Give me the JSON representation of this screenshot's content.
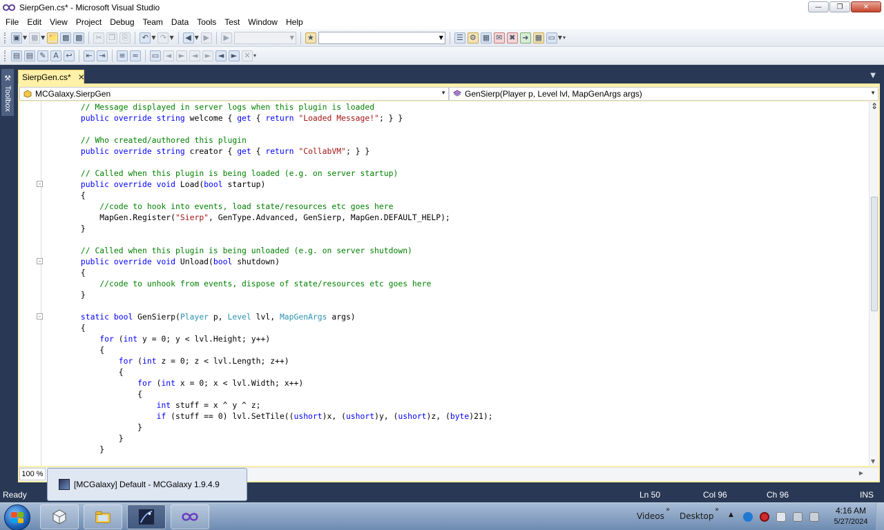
{
  "window": {
    "title": "SierpGen.cs* - Microsoft Visual Studio",
    "minimize_icon": "minimize-icon",
    "maximize_icon": "maximize-icon",
    "close_icon": "close-icon"
  },
  "menu": [
    "File",
    "Edit",
    "View",
    "Project",
    "Debug",
    "Team",
    "Data",
    "Tools",
    "Test",
    "Window",
    "Help"
  ],
  "toolbox": {
    "label": "Toolbox"
  },
  "editor_tab": {
    "label": "SierpGen.cs*"
  },
  "navbar": {
    "type_combo": "MCGalaxy.SierpGen",
    "member_combo": "GenSierp(Player p, Level lvl, MapGenArgs args)"
  },
  "code": {
    "lines": [
      [
        {
          "t": "        "
        },
        {
          "c": "cm",
          "t": "// Message displayed in server logs when this plugin is loaded"
        }
      ],
      [
        {
          "t": "        "
        },
        {
          "c": "kw",
          "t": "public override string"
        },
        {
          "t": " welcome { "
        },
        {
          "c": "kw",
          "t": "get"
        },
        {
          "t": " { "
        },
        {
          "c": "kw",
          "t": "return"
        },
        {
          "t": " "
        },
        {
          "c": "str",
          "t": "\"Loaded Message!\""
        },
        {
          "t": "; } }"
        }
      ],
      [
        {
          "t": ""
        }
      ],
      [
        {
          "t": "        "
        },
        {
          "c": "cm",
          "t": "// Who created/authored this plugin"
        }
      ],
      [
        {
          "t": "        "
        },
        {
          "c": "kw",
          "t": "public override string"
        },
        {
          "t": " creator { "
        },
        {
          "c": "kw",
          "t": "get"
        },
        {
          "t": " { "
        },
        {
          "c": "kw",
          "t": "return"
        },
        {
          "t": " "
        },
        {
          "c": "str",
          "t": "\"CollabVM\""
        },
        {
          "t": "; } }"
        }
      ],
      [
        {
          "t": ""
        }
      ],
      [
        {
          "t": "        "
        },
        {
          "c": "cm",
          "t": "// Called when this plugin is being loaded (e.g. on server startup)"
        }
      ],
      [
        {
          "t": "        "
        },
        {
          "c": "kw",
          "t": "public override void"
        },
        {
          "t": " Load("
        },
        {
          "c": "kw",
          "t": "bool"
        },
        {
          "t": " startup)"
        }
      ],
      [
        {
          "t": "        {"
        }
      ],
      [
        {
          "t": "            "
        },
        {
          "c": "cm",
          "t": "//code to hook into events, load state/resources etc goes here"
        }
      ],
      [
        {
          "t": "            MapGen.Register("
        },
        {
          "c": "str",
          "t": "\"Sierp\""
        },
        {
          "t": ", GenType.Advanced, GenSierp, MapGen.DEFAULT_HELP);"
        }
      ],
      [
        {
          "t": "        }"
        }
      ],
      [
        {
          "t": ""
        }
      ],
      [
        {
          "t": "        "
        },
        {
          "c": "cm",
          "t": "// Called when this plugin is being unloaded (e.g. on server shutdown)"
        }
      ],
      [
        {
          "t": "        "
        },
        {
          "c": "kw",
          "t": "public override void"
        },
        {
          "t": " Unload("
        },
        {
          "c": "kw",
          "t": "bool"
        },
        {
          "t": " shutdown)"
        }
      ],
      [
        {
          "t": "        {"
        }
      ],
      [
        {
          "t": "            "
        },
        {
          "c": "cm",
          "t": "//code to unhook from events, dispose of state/resources etc goes here"
        }
      ],
      [
        {
          "t": "        }"
        }
      ],
      [
        {
          "t": ""
        }
      ],
      [
        {
          "t": "        "
        },
        {
          "c": "kw",
          "t": "static bool"
        },
        {
          "t": " GenSierp("
        },
        {
          "c": "ty",
          "t": "Player"
        },
        {
          "t": " p, "
        },
        {
          "c": "ty",
          "t": "Level"
        },
        {
          "t": " lvl, "
        },
        {
          "c": "ty",
          "t": "MapGenArgs"
        },
        {
          "t": " args)"
        }
      ],
      [
        {
          "t": "        {"
        }
      ],
      [
        {
          "t": "            "
        },
        {
          "c": "kw",
          "t": "for"
        },
        {
          "t": " ("
        },
        {
          "c": "kw",
          "t": "int"
        },
        {
          "t": " y = 0; y < lvl.Height; y++)"
        }
      ],
      [
        {
          "t": "            {"
        }
      ],
      [
        {
          "t": "                "
        },
        {
          "c": "kw",
          "t": "for"
        },
        {
          "t": " ("
        },
        {
          "c": "kw",
          "t": "int"
        },
        {
          "t": " z = 0; z < lvl.Length; z++)"
        }
      ],
      [
        {
          "t": "                {"
        }
      ],
      [
        {
          "t": "                    "
        },
        {
          "c": "kw",
          "t": "for"
        },
        {
          "t": " ("
        },
        {
          "c": "kw",
          "t": "int"
        },
        {
          "t": " x = 0; x < lvl.Width; x++)"
        }
      ],
      [
        {
          "t": "                    {"
        }
      ],
      [
        {
          "t": "                        "
        },
        {
          "c": "kw",
          "t": "int"
        },
        {
          "t": " stuff = x ^ y ^ z;"
        }
      ],
      [
        {
          "t": "                        "
        },
        {
          "c": "kw",
          "t": "if"
        },
        {
          "t": " (stuff == 0) lvl.SetTile(("
        },
        {
          "c": "kw",
          "t": "ushort"
        },
        {
          "t": ")x, ("
        },
        {
          "c": "kw",
          "t": "ushort"
        },
        {
          "t": ")y, ("
        },
        {
          "c": "kw",
          "t": "ushort"
        },
        {
          "t": ")z, ("
        },
        {
          "c": "kw",
          "t": "byte"
        },
        {
          "t": ")21);"
        }
      ],
      [
        {
          "t": "                    }"
        }
      ],
      [
        {
          "t": "                }"
        }
      ],
      [
        {
          "t": "            }"
        }
      ]
    ]
  },
  "zoom": "100 %",
  "status": {
    "ready": "Ready",
    "ln": "Ln 50",
    "col": "Col 96",
    "ch": "Ch 96",
    "ins": "INS"
  },
  "preview": {
    "label": "[MCGalaxy] Default - MCGalaxy 1.9.4.9"
  },
  "taskbar": {
    "toolbars": [
      "Videos",
      "Desktop"
    ],
    "time": "4:16 AM",
    "date": "5/27/2024"
  }
}
